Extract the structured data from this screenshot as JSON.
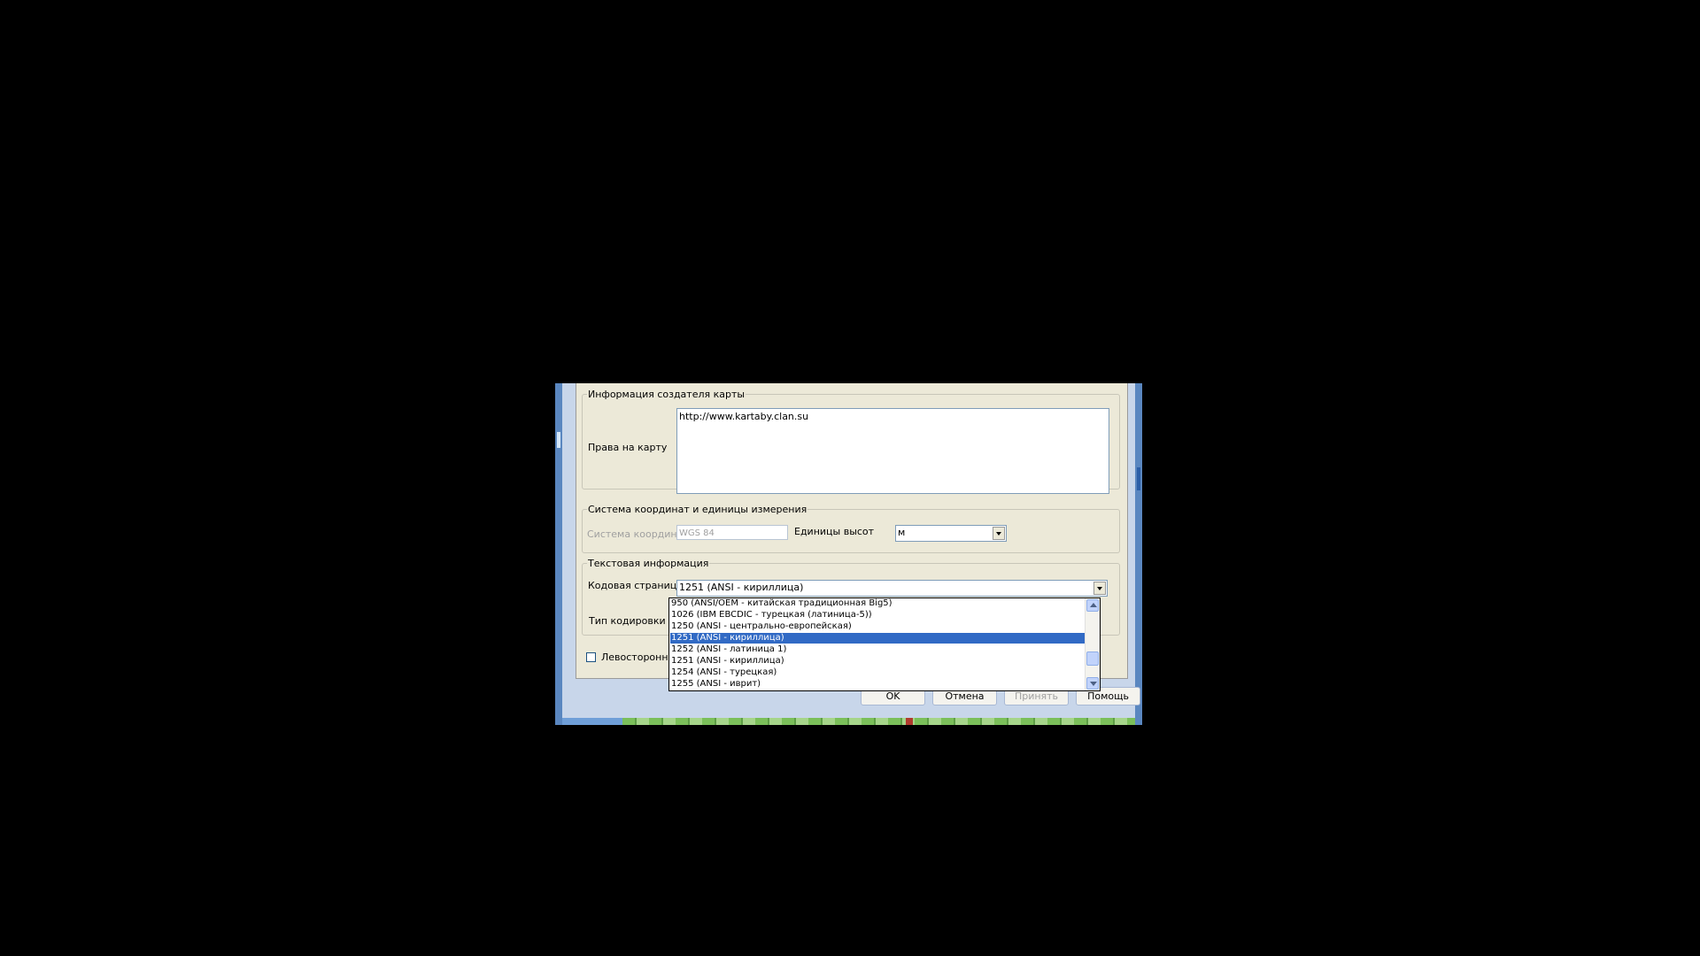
{
  "group_creator": {
    "title": "Информация создателя карты",
    "copyright_label": "Права на карту",
    "copyright_value": "http://www.kartaby.clan.su"
  },
  "group_coords": {
    "title": "Система координат и единицы измерения",
    "coord_system_label": "Система координат",
    "coord_system_value": "WGS 84",
    "height_units_label": "Единицы высот",
    "height_units_value": "м"
  },
  "group_text": {
    "title": "Текстовая информация",
    "codepage_label": "Кодовая страница",
    "codepage_value": "1251  (ANSI - кириллица)",
    "encoding_label": "Тип кодировки"
  },
  "left_traffic_checkbox": {
    "label": "Левостороннее д",
    "checked": false
  },
  "codepage_dropdown": {
    "options": [
      "950   (ANSI/OEM - китайская традиционная Big5)",
      "1026 (IBM EBCDIC - турецкая (латиница-5))",
      "1250  (ANSI - центрально-европейская)",
      "1251  (ANSI - кириллица)",
      "1252  (ANSI - латиница 1)",
      "1251  (ANSI - кириллица)",
      "1254  (ANSI - турецкая)",
      "1255  (ANSI - иврит)"
    ],
    "selected_index": 3
  },
  "buttons": {
    "ok": "OK",
    "cancel": "Отмена",
    "apply": "Принять",
    "help": "Помощь"
  },
  "colors": {
    "dialog_face": "#ece9d8",
    "selection": "#316ac5",
    "frame": "#5a87c0",
    "background": "#000000"
  }
}
